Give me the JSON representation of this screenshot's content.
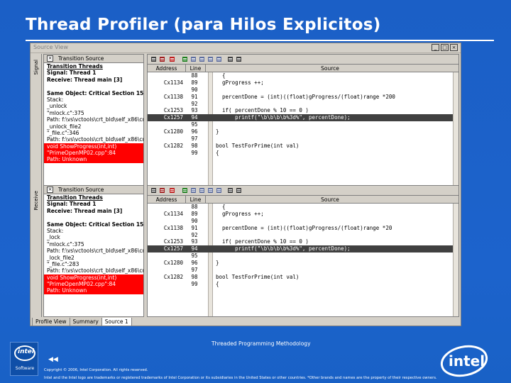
{
  "slide": {
    "title": "Thread Profiler (para Hilos Explicitos)",
    "footer_center": "Threaded Programming Methodology",
    "nav_back": "◀◀",
    "copyright": "Copyright © 2006, Intel Corporation. All rights reserved.",
    "trademark": "Intel and the Intel logo are trademarks or registered trademarks of Intel Corporation or its subsidiaries in the United States or other countries. *Other brands and names are the property of their respective owners.",
    "logo_small_word": "intel",
    "logo_small_sub": "Software",
    "logo_big_word": "intel",
    "brand_color": "#1c63cc"
  },
  "window": {
    "title": "Source View",
    "buttons": [
      "_",
      "□",
      "×"
    ]
  },
  "panes": [
    {
      "vtab_label": "Signal",
      "left_header": "Transition Source",
      "left_lines": [
        {
          "text": "Transition Threads",
          "style": "b u"
        },
        {
          "text": "Signal:  Thread 1",
          "style": "b"
        },
        {
          "text": "Receive:  Thread main [3]",
          "style": "b"
        },
        {
          "text": "",
          "style": ""
        },
        {
          "text": "Same Object: Critical Section 15",
          "style": "b"
        },
        {
          "text": "Stack:",
          "style": ""
        },
        {
          "text": "_unlock",
          "style": ""
        },
        {
          "text": "\"mlock.c\":375",
          "style": ""
        },
        {
          "text": "Path: f:\\vs\\vctools\\crt_bld\\self_x86\\cr",
          "style": ""
        },
        {
          "text": "_unlock_file2",
          "style": ""
        },
        {
          "text": "\"_file.c\":346",
          "style": ""
        },
        {
          "text": "Path: f:\\vs\\vctools\\crt_bld\\self_x86\\cr",
          "style": ""
        },
        {
          "text": "void ShowProgress(int,int)",
          "style": "red"
        },
        {
          "text": "\"PrimeOpenMP02.cpp\":84",
          "style": "red"
        },
        {
          "text": "Path: Unknown",
          "style": "red"
        }
      ],
      "grid_headers": [
        "Address",
        "Line",
        "Source"
      ],
      "rows": [
        {
          "addr": "",
          "line": "88",
          "src": "  {"
        },
        {
          "addr": "Cx1134",
          "line": "89",
          "src": "  gProgress ++;"
        },
        {
          "addr": "",
          "line": "90",
          "src": ""
        },
        {
          "addr": "Cx1138",
          "line": "91",
          "src": "  percentDone = (int)((float)gProgress/(float)range *200"
        },
        {
          "addr": "",
          "line": "92",
          "src": ""
        },
        {
          "addr": "Cx1253",
          "line": "93",
          "src": "  if( percentDone % 10 == 0 )"
        },
        {
          "addr": "Cx1257",
          "line": "94",
          "src": "      printf(\"\\b\\b\\b\\b%3d%\", percentDone);",
          "hl": true
        },
        {
          "addr": "",
          "line": "95",
          "src": ""
        },
        {
          "addr": "Cx1280",
          "line": "96",
          "src": "}"
        },
        {
          "addr": "",
          "line": "97",
          "src": ""
        },
        {
          "addr": "Cx1282",
          "line": "98",
          "src": "bool TestForPrime(int val)"
        },
        {
          "addr": "",
          "line": "99",
          "src": "{"
        }
      ]
    },
    {
      "vtab_label": "Receive",
      "left_header": "Transition Source",
      "left_lines": [
        {
          "text": "Transition Threads",
          "style": "b u"
        },
        {
          "text": "Signal:  Thread 1",
          "style": "b"
        },
        {
          "text": "Receive:  Thread main [3]",
          "style": "b"
        },
        {
          "text": "",
          "style": ""
        },
        {
          "text": "Same Object: Critical Section 15",
          "style": "b"
        },
        {
          "text": "Stack:",
          "style": ""
        },
        {
          "text": "_lock",
          "style": ""
        },
        {
          "text": "\"mlock.c\":375",
          "style": ""
        },
        {
          "text": "Path: f:\\vs\\vctools\\crt_bld\\self_x86\\cr",
          "style": ""
        },
        {
          "text": "_lock_file2",
          "style": ""
        },
        {
          "text": "\"_file.c\":283",
          "style": ""
        },
        {
          "text": "Path: f:\\vs\\vctools\\crt_bld\\self_x86\\cr",
          "style": ""
        },
        {
          "text": "void ShowProgress(int,int)",
          "style": "red"
        },
        {
          "text": "\"PrimeOpenMP02.cpp\":84",
          "style": "red"
        },
        {
          "text": "Path: Unknown",
          "style": "red"
        }
      ],
      "grid_headers": [
        "Address",
        "Line",
        "Source"
      ],
      "rows": [
        {
          "addr": "",
          "line": "88",
          "src": "  {"
        },
        {
          "addr": "Cx1134",
          "line": "89",
          "src": "  gProgress ++;"
        },
        {
          "addr": "",
          "line": "90",
          "src": ""
        },
        {
          "addr": "Cx1138",
          "line": "91",
          "src": "  percentDone = (int)((float)gProgress/(float)range *20"
        },
        {
          "addr": "",
          "line": "92",
          "src": ""
        },
        {
          "addr": "Cx1253",
          "line": "93",
          "src": "  if( percentDone % 10 == 0 )"
        },
        {
          "addr": "Cx1257",
          "line": "94",
          "src": "      printf(\"\\b\\b\\b\\b%3d%\", percentDone);",
          "hl": true
        },
        {
          "addr": "",
          "line": "95",
          "src": ""
        },
        {
          "addr": "Cx1280",
          "line": "96",
          "src": "}"
        },
        {
          "addr": "",
          "line": "97",
          "src": ""
        },
        {
          "addr": "Cx1282",
          "line": "98",
          "src": "bool TestForPrime(int val)"
        },
        {
          "addr": "",
          "line": "99",
          "src": "{"
        }
      ]
    }
  ],
  "bottom_tabs": [
    {
      "label": "Profile View",
      "active": false
    },
    {
      "label": "Summary",
      "active": false
    },
    {
      "label": "Source 1",
      "active": true
    }
  ],
  "toolbar_icons": [
    "list-icon",
    "list-red-icon",
    "stop-red-icon",
    "nav-icon",
    "nav-icon",
    "nav-icon",
    "nav-icon",
    "nav-icon",
    "arrow-icon",
    "arrow-icon"
  ]
}
